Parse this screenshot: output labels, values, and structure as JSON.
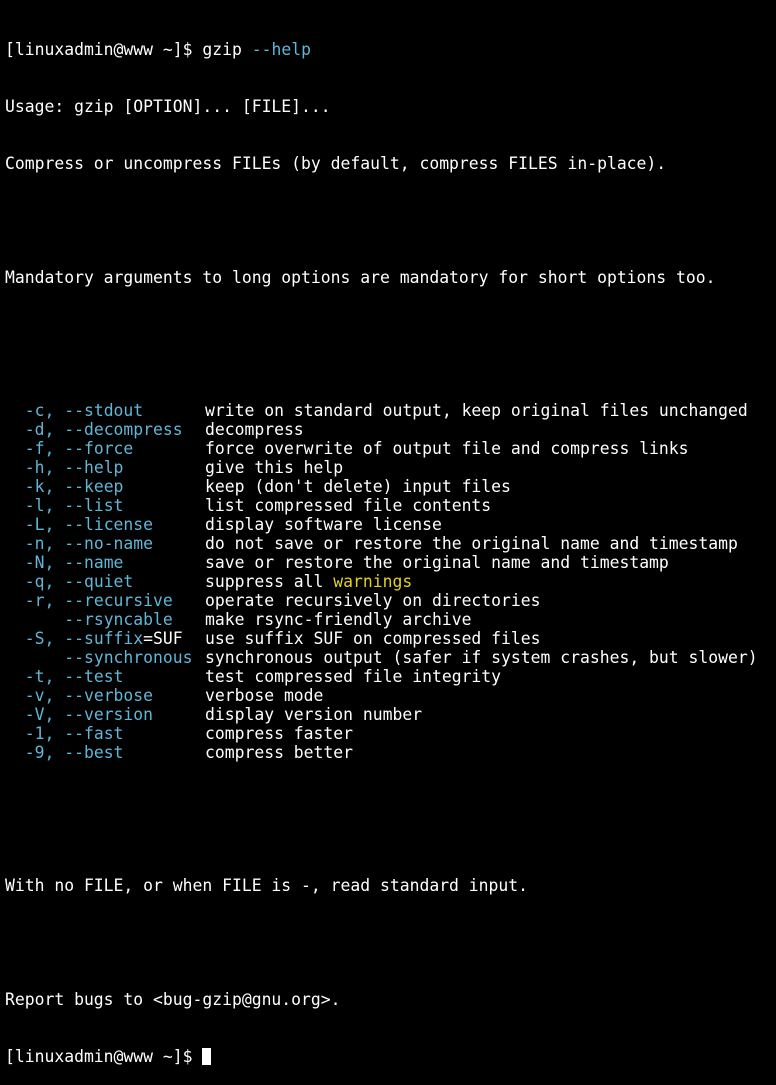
{
  "prompt": {
    "text": "[linuxadmin@www ~]$ ",
    "command": "gzip",
    "command_arg": " --help"
  },
  "header": {
    "usage": "Usage: gzip [OPTION]... [FILE]...",
    "description": "Compress or uncompress FILEs (by default, compress FILES in-place).",
    "mandatory_note": "Mandatory arguments to long options are mandatory for short options too."
  },
  "options": [
    {
      "short": "  -c, ",
      "long": "--stdout",
      "tail": "",
      "desc_pre": "write on standard output, keep original files unchanged",
      "highlight": "",
      "desc_post": ""
    },
    {
      "short": "  -d, ",
      "long": "--decompress",
      "tail": "",
      "desc_pre": "decompress",
      "highlight": "",
      "desc_post": ""
    },
    {
      "short": "  -f, ",
      "long": "--force",
      "tail": "",
      "desc_pre": "force overwrite of output file and compress links",
      "highlight": "",
      "desc_post": ""
    },
    {
      "short": "  -h, ",
      "long": "--help",
      "tail": "",
      "desc_pre": "give this help",
      "highlight": "",
      "desc_post": ""
    },
    {
      "short": "  -k, ",
      "long": "--keep",
      "tail": "",
      "desc_pre": "keep (don't delete) input files",
      "highlight": "",
      "desc_post": ""
    },
    {
      "short": "  -l, ",
      "long": "--list",
      "tail": "",
      "desc_pre": "list compressed file contents",
      "highlight": "",
      "desc_post": ""
    },
    {
      "short": "  -L, ",
      "long": "--license",
      "tail": "",
      "desc_pre": "display software license",
      "highlight": "",
      "desc_post": ""
    },
    {
      "short": "  -n, ",
      "long": "--no-name",
      "tail": "",
      "desc_pre": "do not save or restore the original name and timestamp",
      "highlight": "",
      "desc_post": ""
    },
    {
      "short": "  -N, ",
      "long": "--name",
      "tail": "",
      "desc_pre": "save or restore the original name and timestamp",
      "highlight": "",
      "desc_post": ""
    },
    {
      "short": "  -q, ",
      "long": "--quiet",
      "tail": "",
      "desc_pre": "suppress all ",
      "highlight": "warnings",
      "desc_post": ""
    },
    {
      "short": "  -r, ",
      "long": "--recursive",
      "tail": "",
      "desc_pre": "operate recursively on directories",
      "highlight": "",
      "desc_post": ""
    },
    {
      "short": "      ",
      "long": "--rsyncable",
      "tail": "",
      "desc_pre": "make rsync-friendly archive",
      "highlight": "",
      "desc_post": ""
    },
    {
      "short": "  -S, ",
      "long": "--suffix",
      "tail": "=SUF",
      "desc_pre": "use suffix SUF on compressed files",
      "highlight": "",
      "desc_post": ""
    },
    {
      "short": "      ",
      "long": "--synchronous",
      "tail": "",
      "desc_pre": "synchronous output (safer if system crashes, but slower)",
      "highlight": "",
      "desc_post": ""
    },
    {
      "short": "  -t, ",
      "long": "--test",
      "tail": "",
      "desc_pre": "test compressed file integrity",
      "highlight": "",
      "desc_post": ""
    },
    {
      "short": "  -v, ",
      "long": "--verbose",
      "tail": "",
      "desc_pre": "verbose mode",
      "highlight": "",
      "desc_post": ""
    },
    {
      "short": "  -V, ",
      "long": "--version",
      "tail": "",
      "desc_pre": "display version number",
      "highlight": "",
      "desc_post": ""
    },
    {
      "short": "  -1, ",
      "long": "--fast",
      "tail": "",
      "desc_pre": "compress faster",
      "highlight": "",
      "desc_post": ""
    },
    {
      "short": "  -9, ",
      "long": "--best",
      "tail": "",
      "desc_pre": "compress better",
      "highlight": "",
      "desc_post": ""
    }
  ],
  "footer": {
    "stdin_note": "With no FILE, or when FILE is -, read standard input.",
    "bugs": "Report bugs to <bug-gzip@gnu.org>.",
    "next_prompt": "[linuxadmin@www ~]$ "
  },
  "colors": {
    "background": "#000000",
    "foreground": "#ffffff",
    "option_cyan": "#5fb6d6",
    "highlight_yellow": "#e3d11a"
  }
}
